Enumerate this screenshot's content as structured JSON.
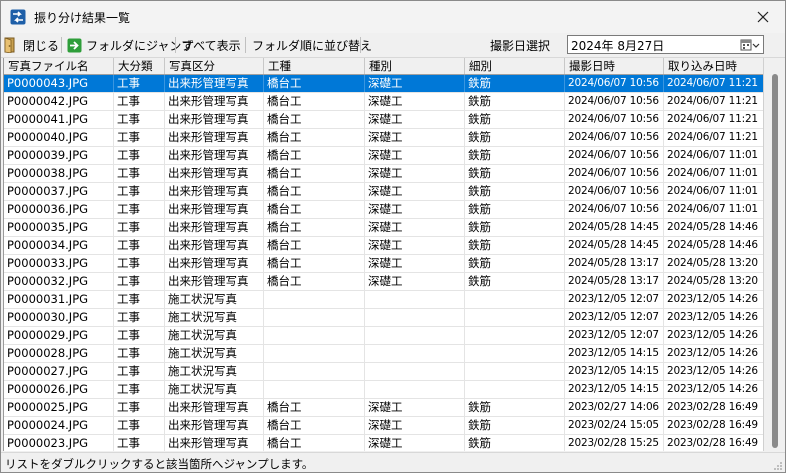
{
  "window": {
    "title": "振り分け結果一覧"
  },
  "toolbar": {
    "close_label": "閉じる",
    "jump_label": "フォルダにジャンプ",
    "show_all_label": "すべて表示",
    "sort_folder_label": "フォルダ順に並び替え",
    "date_label": "撮影日選択",
    "date_value": "2024年  8月27日"
  },
  "table": {
    "columns": [
      "写真ファイル名",
      "大分類",
      "写真区分",
      "工種",
      "種別",
      "細別",
      "撮影日時",
      "取り込み日時"
    ],
    "rows": [
      [
        "P0000043.JPG",
        "工事",
        "出来形管理写真",
        "橋台工",
        "深礎工",
        "鉄筋",
        "2024/06/07 10:56",
        "2024/06/07 11:21"
      ],
      [
        "P0000042.JPG",
        "工事",
        "出来形管理写真",
        "橋台工",
        "深礎工",
        "鉄筋",
        "2024/06/07 10:56",
        "2024/06/07 11:21"
      ],
      [
        "P0000041.JPG",
        "工事",
        "出来形管理写真",
        "橋台工",
        "深礎工",
        "鉄筋",
        "2024/06/07 10:56",
        "2024/06/07 11:21"
      ],
      [
        "P0000040.JPG",
        "工事",
        "出来形管理写真",
        "橋台工",
        "深礎工",
        "鉄筋",
        "2024/06/07 10:56",
        "2024/06/07 11:21"
      ],
      [
        "P0000039.JPG",
        "工事",
        "出来形管理写真",
        "橋台工",
        "深礎工",
        "鉄筋",
        "2024/06/07 10:56",
        "2024/06/07 11:01"
      ],
      [
        "P0000038.JPG",
        "工事",
        "出来形管理写真",
        "橋台工",
        "深礎工",
        "鉄筋",
        "2024/06/07 10:56",
        "2024/06/07 11:01"
      ],
      [
        "P0000037.JPG",
        "工事",
        "出来形管理写真",
        "橋台工",
        "深礎工",
        "鉄筋",
        "2024/06/07 10:56",
        "2024/06/07 11:01"
      ],
      [
        "P0000036.JPG",
        "工事",
        "出来形管理写真",
        "橋台工",
        "深礎工",
        "鉄筋",
        "2024/06/07 10:56",
        "2024/06/07 11:01"
      ],
      [
        "P0000035.JPG",
        "工事",
        "出来形管理写真",
        "橋台工",
        "深礎工",
        "鉄筋",
        "2024/05/28 14:45",
        "2024/05/28 14:46"
      ],
      [
        "P0000034.JPG",
        "工事",
        "出来形管理写真",
        "橋台工",
        "深礎工",
        "鉄筋",
        "2024/05/28 14:45",
        "2024/05/28 14:46"
      ],
      [
        "P0000033.JPG",
        "工事",
        "出来形管理写真",
        "橋台工",
        "深礎工",
        "鉄筋",
        "2024/05/28 13:17",
        "2024/05/28 13:20"
      ],
      [
        "P0000032.JPG",
        "工事",
        "出来形管理写真",
        "橋台工",
        "深礎工",
        "鉄筋",
        "2024/05/28 13:17",
        "2024/05/28 13:20"
      ],
      [
        "P0000031.JPG",
        "工事",
        "施工状況写真",
        "",
        "",
        "",
        "2023/12/05 12:07",
        "2023/12/05 14:26"
      ],
      [
        "P0000030.JPG",
        "工事",
        "施工状況写真",
        "",
        "",
        "",
        "2023/12/05 12:07",
        "2023/12/05 14:26"
      ],
      [
        "P0000029.JPG",
        "工事",
        "施工状況写真",
        "",
        "",
        "",
        "2023/12/05 12:07",
        "2023/12/05 14:26"
      ],
      [
        "P0000028.JPG",
        "工事",
        "施工状況写真",
        "",
        "",
        "",
        "2023/12/05 14:15",
        "2023/12/05 14:26"
      ],
      [
        "P0000027.JPG",
        "工事",
        "施工状況写真",
        "",
        "",
        "",
        "2023/12/05 14:15",
        "2023/12/05 14:26"
      ],
      [
        "P0000026.JPG",
        "工事",
        "施工状況写真",
        "",
        "",
        "",
        "2023/12/05 14:15",
        "2023/12/05 14:26"
      ],
      [
        "P0000025.JPG",
        "工事",
        "出来形管理写真",
        "橋台工",
        "深礎工",
        "鉄筋",
        "2023/02/27 14:06",
        "2023/02/28 16:49"
      ],
      [
        "P0000024.JPG",
        "工事",
        "出来形管理写真",
        "橋台工",
        "深礎工",
        "鉄筋",
        "2023/02/24 15:05",
        "2023/02/28 16:49"
      ],
      [
        "P0000023.JPG",
        "工事",
        "出来形管理写真",
        "橋台工",
        "深礎工",
        "鉄筋",
        "2023/02/28 15:25",
        "2023/02/28 16:49"
      ]
    ],
    "selected_row": 0
  },
  "status": {
    "text": "リストをダブルクリックすると該当箇所へジャンプします。"
  },
  "icons": {
    "app": "app-icon",
    "close": "close-icon",
    "door": "door-icon",
    "jump": "jump-arrow-icon",
    "calendar": "calendar-dropdown-icon"
  },
  "colors": {
    "selection": "#0078d7",
    "jump_icon": "#2e9e3a"
  }
}
